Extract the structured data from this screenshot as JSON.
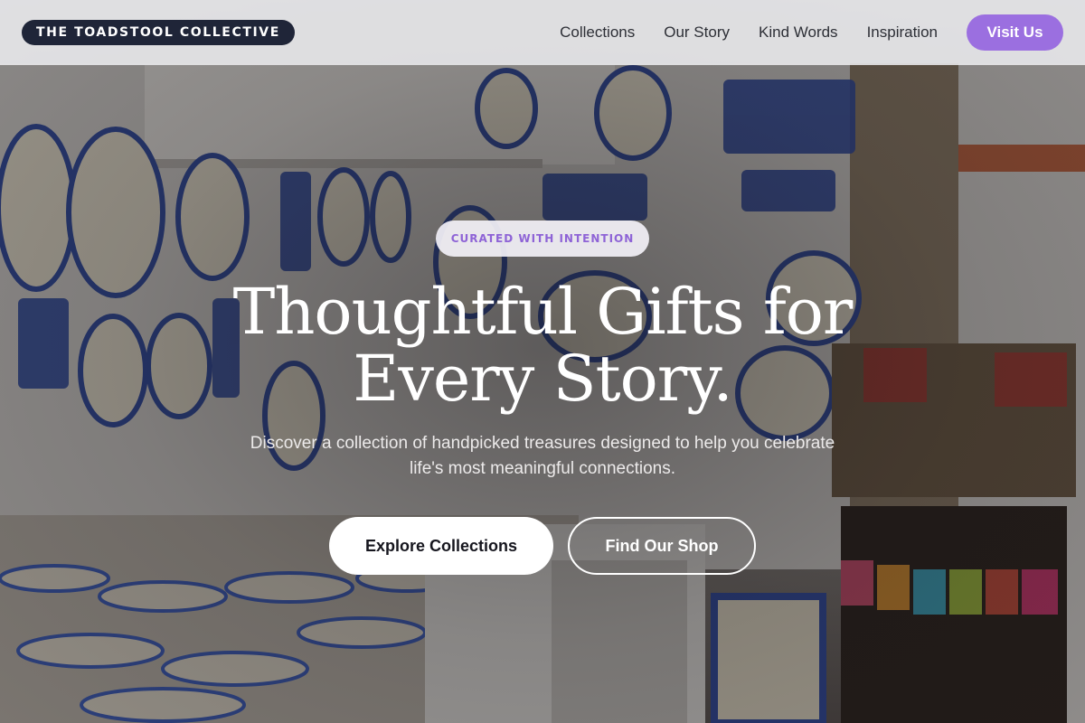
{
  "brand": {
    "name": "THE TOADSTOOL COLLECTIVE"
  },
  "nav": {
    "links": [
      "Collections",
      "Our Story",
      "Kind Words",
      "Inspiration"
    ],
    "cta": "Visit Us"
  },
  "hero": {
    "eyebrow": "CURATED WITH INTENTION",
    "headline_line1": "Thoughtful Gifts for",
    "headline_line2": "Every Story.",
    "subtext": "Discover a collection of handpicked treasures designed to help you celebrate life's most meaningful connections.",
    "primary_cta": "Explore Collections",
    "secondary_cta": "Find Our Shop",
    "background_image": "pottery shop with hand-painted ceramic plates"
  },
  "colors": {
    "brand_bg": "#1f2538",
    "accent_purple": "#9b6fe0",
    "eyebrow_text": "#8e63d6",
    "nav_bg": "#ececee"
  }
}
